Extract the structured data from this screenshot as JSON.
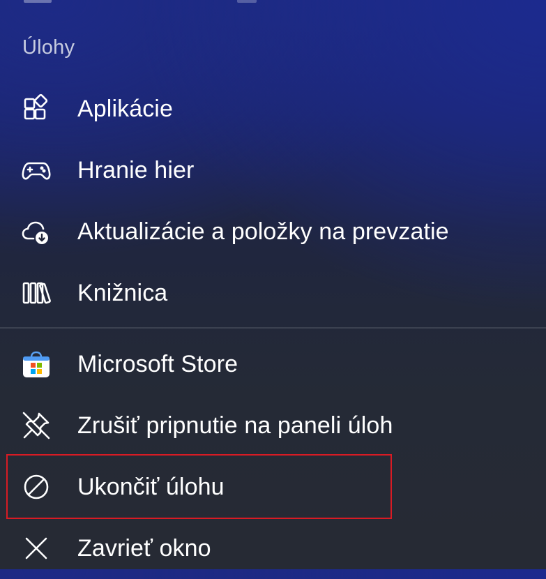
{
  "section_header": "Úlohy",
  "menu": {
    "items": [
      {
        "label": "Aplikácie",
        "icon": "apps-icon"
      },
      {
        "label": "Hranie hier",
        "icon": "gamepad-icon"
      },
      {
        "label": "Aktualizácie a položky na prevzatie",
        "icon": "cloud-download-icon"
      },
      {
        "label": "Knižnica",
        "icon": "library-icon"
      },
      {
        "label": "Microsoft Store",
        "icon": "microsoft-store-icon"
      },
      {
        "label": "Zrušiť pripnutie na paneli úloh",
        "icon": "unpin-icon"
      },
      {
        "label": "Ukončiť úlohu",
        "icon": "end-task-icon",
        "highlighted": true
      },
      {
        "label": "Zavrieť okno",
        "icon": "close-icon"
      }
    ]
  },
  "colors": {
    "highlight_border": "#d81b24",
    "store_icon_blue": "#3b82f6",
    "store_red": "#f25022",
    "store_green": "#7fba00",
    "store_blue": "#00a4ef",
    "store_yellow": "#ffb900"
  }
}
